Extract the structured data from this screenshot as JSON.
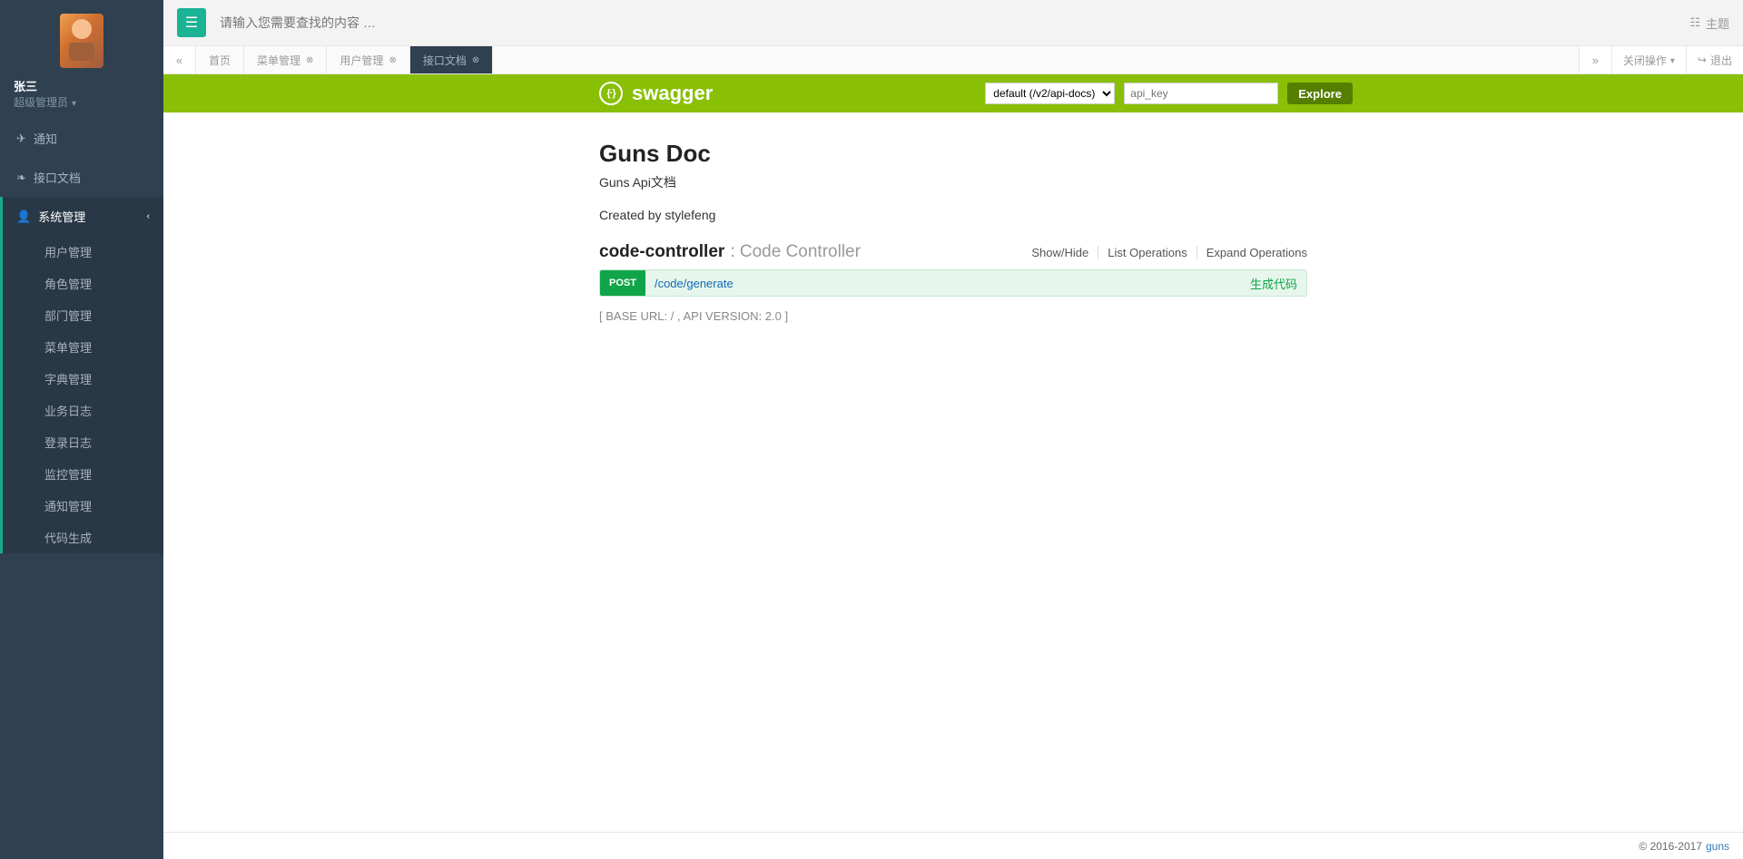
{
  "user": {
    "name": "张三",
    "role": "超级管理员"
  },
  "topbar": {
    "search_placeholder": "请输入您需要查找的内容 …",
    "theme": "主题"
  },
  "sidebar": {
    "items": [
      {
        "label": "通知",
        "icon": "paper-plane"
      },
      {
        "label": "接口文档",
        "icon": "leaf"
      },
      {
        "label": "系统管理",
        "icon": "user",
        "open": true,
        "children": [
          {
            "label": "用户管理"
          },
          {
            "label": "角色管理"
          },
          {
            "label": "部门管理"
          },
          {
            "label": "菜单管理"
          },
          {
            "label": "字典管理"
          },
          {
            "label": "业务日志"
          },
          {
            "label": "登录日志"
          },
          {
            "label": "监控管理"
          },
          {
            "label": "通知管理"
          },
          {
            "label": "代码生成"
          }
        ]
      }
    ]
  },
  "tabs": {
    "list": [
      {
        "label": "首页",
        "closable": false
      },
      {
        "label": "菜单管理",
        "closable": true
      },
      {
        "label": "用户管理",
        "closable": true
      },
      {
        "label": "接口文档",
        "closable": true,
        "active": true
      }
    ],
    "actions": {
      "close_ops": "关闭操作",
      "logout": "退出"
    }
  },
  "swagger": {
    "logo": "swagger",
    "select_value": "default (/v2/api-docs)",
    "apikey_placeholder": "api_key",
    "explore": "Explore",
    "doc_title": "Guns Doc",
    "doc_sub": "Guns Api文档",
    "created_by": "Created by stylefeng",
    "controller_name": "code-controller",
    "controller_desc": " : Code Controller",
    "ops": {
      "show": "Show/Hide",
      "list": "List Operations",
      "expand": "Expand Operations"
    },
    "endpoint": {
      "method": "POST",
      "path": "/code/generate",
      "summary": "生成代码"
    },
    "base_line": "[ BASE URL: / , API VERSION: 2.0 ]"
  },
  "footer": {
    "copyright": "© 2016-2017",
    "link": "guns"
  }
}
